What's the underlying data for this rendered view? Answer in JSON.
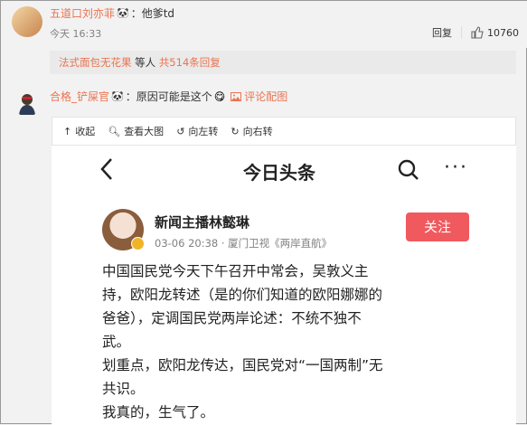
{
  "comment1": {
    "username": "五道口刘亦菲",
    "emoji": "🐼",
    "text": "：他爹td",
    "time": "今天 16:33",
    "reply_label": "回复",
    "like_count": "10760",
    "colors": {
      "name": "#eb7350"
    }
  },
  "reply_summary": {
    "user": "法式面包无花果",
    "middle": " 等人 ",
    "count_link": "共514条回复"
  },
  "comment2": {
    "username": "合格_铲屎官",
    "emoji": "🐼",
    "text": "：原因可能是这个",
    "emoji2": "😋",
    "image_link": "评论配图"
  },
  "image_toolbar": {
    "collapse": "收起",
    "view_large": "查看大图",
    "rotate_left": "向左转",
    "rotate_right": "向右转"
  },
  "screenshot": {
    "app_title": "今日头条",
    "author": "新闻主播林懿琳",
    "meta": "03-06 20:38 · 厦门卫视《两岸直航》",
    "follow": "关注",
    "body": [
      "中国国民党今天下午召开中常会，吴敦义主",
      "持，欧阳龙转述（是的你们知道的欧阳娜娜的",
      "爸爸），定调国民党两岸论述：不统不独不",
      "武。",
      "划重点，欧阳龙传达，国民党对“一国两制”无",
      "共识。",
      "我真的，生气了。"
    ]
  }
}
